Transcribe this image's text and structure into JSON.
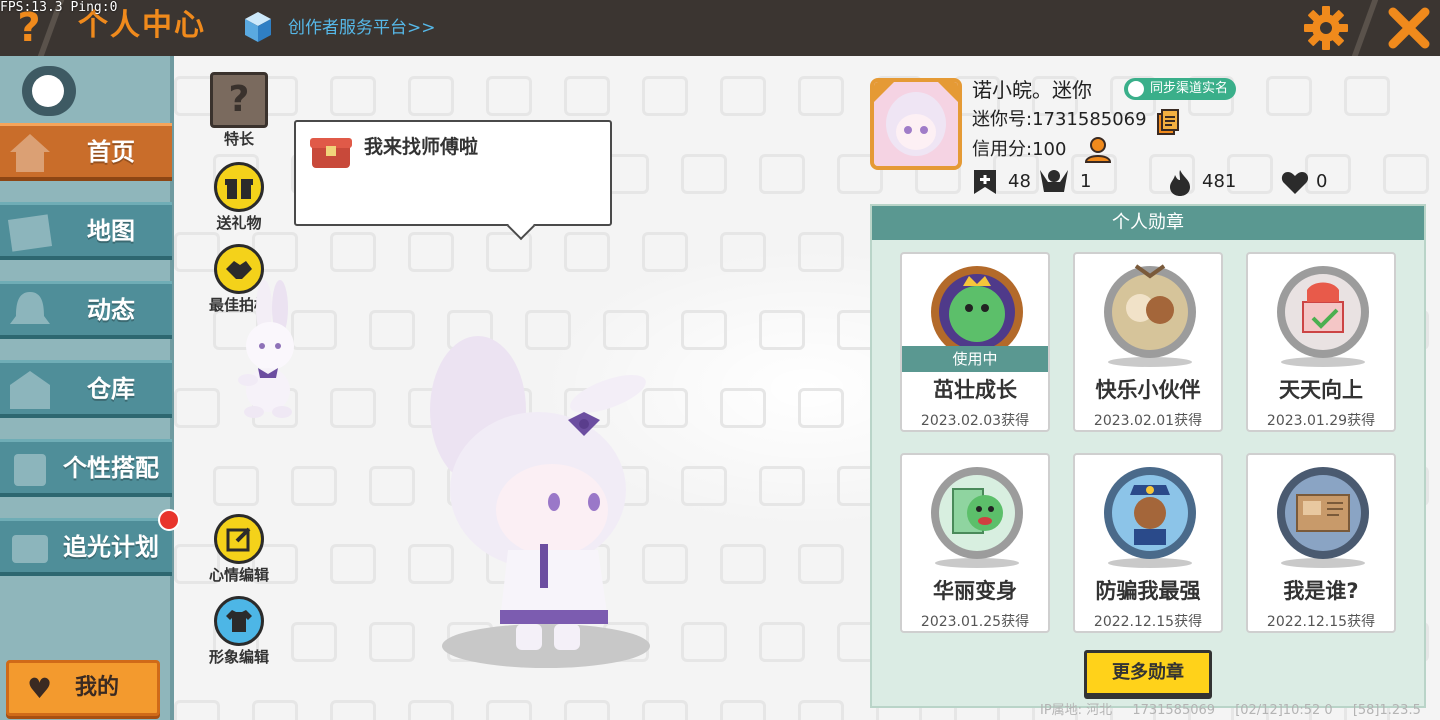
{
  "debug": {
    "fps": "FPS:13.3",
    "ping": "Ping:0"
  },
  "header": {
    "title": "个人中心",
    "creator_link": "创作者服务平台>>"
  },
  "sidebar": {
    "items": [
      {
        "label": "首页",
        "active": true
      },
      {
        "label": "地图"
      },
      {
        "label": "动态"
      },
      {
        "label": "仓库"
      },
      {
        "label": "个性搭配"
      },
      {
        "label": "追光计划"
      }
    ],
    "mine_label": "我的"
  },
  "actions": {
    "specialty": "特长",
    "gift": "送礼物",
    "best_partner": "最佳拍档",
    "mood_edit": "心情编辑",
    "look_edit": "形象编辑"
  },
  "bubble": {
    "text": "我来找师傅啦"
  },
  "profile": {
    "name": "诺小皖。迷你",
    "verify_label": "同步渠道实名",
    "mini_id": "迷你号:1731585069",
    "credit": "信用分:100",
    "stats": {
      "bookmarks": "48",
      "followers": "1",
      "popularity": "481",
      "likes": "0"
    }
  },
  "badges": {
    "title": "个人勋章",
    "in_use_label": "使用中",
    "items": [
      {
        "name": "茁壮成长",
        "date": "2023.02.03获得"
      },
      {
        "name": "快乐小伙伴",
        "date": "2023.02.01获得"
      },
      {
        "name": "天天向上",
        "date": "2023.01.29获得"
      },
      {
        "name": "华丽变身",
        "date": "2023.01.25获得"
      },
      {
        "name": "防骗我最强",
        "date": "2022.12.15获得"
      },
      {
        "name": "我是谁?",
        "date": "2022.12.15获得"
      }
    ],
    "more_label": "更多勋章"
  },
  "footer": {
    "ip": "IP属地: 河北",
    "uid": "1731585069",
    "time": "[02/12]10:52 0",
    "version": "[58]1.23.5"
  },
  "colors": {
    "accent": "#f08a1c",
    "sidebar": "#4f8e99",
    "active_tab": "#c96d2a",
    "badge_header": "#5a9891",
    "more_button": "#ffd21a"
  }
}
